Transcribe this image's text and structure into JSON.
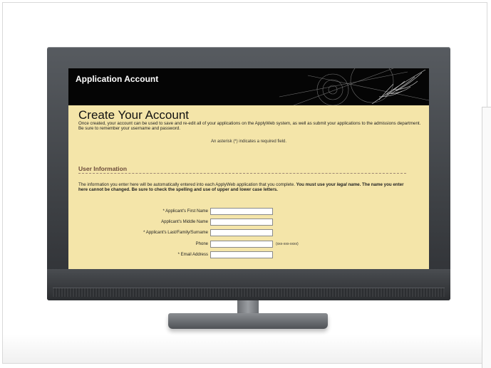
{
  "app": {
    "header_title": "Application Account"
  },
  "page": {
    "title": "Create Your Account",
    "intro": "Once created, your account can be used to save and re-edit all of your applications on the ApplyWeb system, as well as submit your applications to the admissions department. Be sure to remember your username and password.",
    "required_note": "An asterisk (*) indicates a required field."
  },
  "section": {
    "heading": "User Information",
    "info_plain": "The information you enter here will be automatically entered into each ApplyWeb application that you complete. ",
    "info_bold_1": "You must use your ",
    "info_bold_italic": "legal name",
    "info_bold_2": ". The name you enter here cannot be changed. Be sure to check the spelling and use of upper and lower case letters."
  },
  "form": {
    "fields": [
      {
        "label": "* Applicant's First Name",
        "value": "",
        "hint": ""
      },
      {
        "label": "Applicant's Middle Name",
        "value": "",
        "hint": ""
      },
      {
        "label": "* Applicant's Last/Family/Surname",
        "value": "",
        "hint": ""
      },
      {
        "label": "Phone",
        "value": "",
        "hint": "(xxx-xxx-xxxx)"
      },
      {
        "label": "* Email Address",
        "value": "",
        "hint": ""
      }
    ]
  },
  "colors": {
    "screen_background": "#f4e5a9",
    "header_background": "#050505",
    "section_heading": "#6b4a3a"
  }
}
